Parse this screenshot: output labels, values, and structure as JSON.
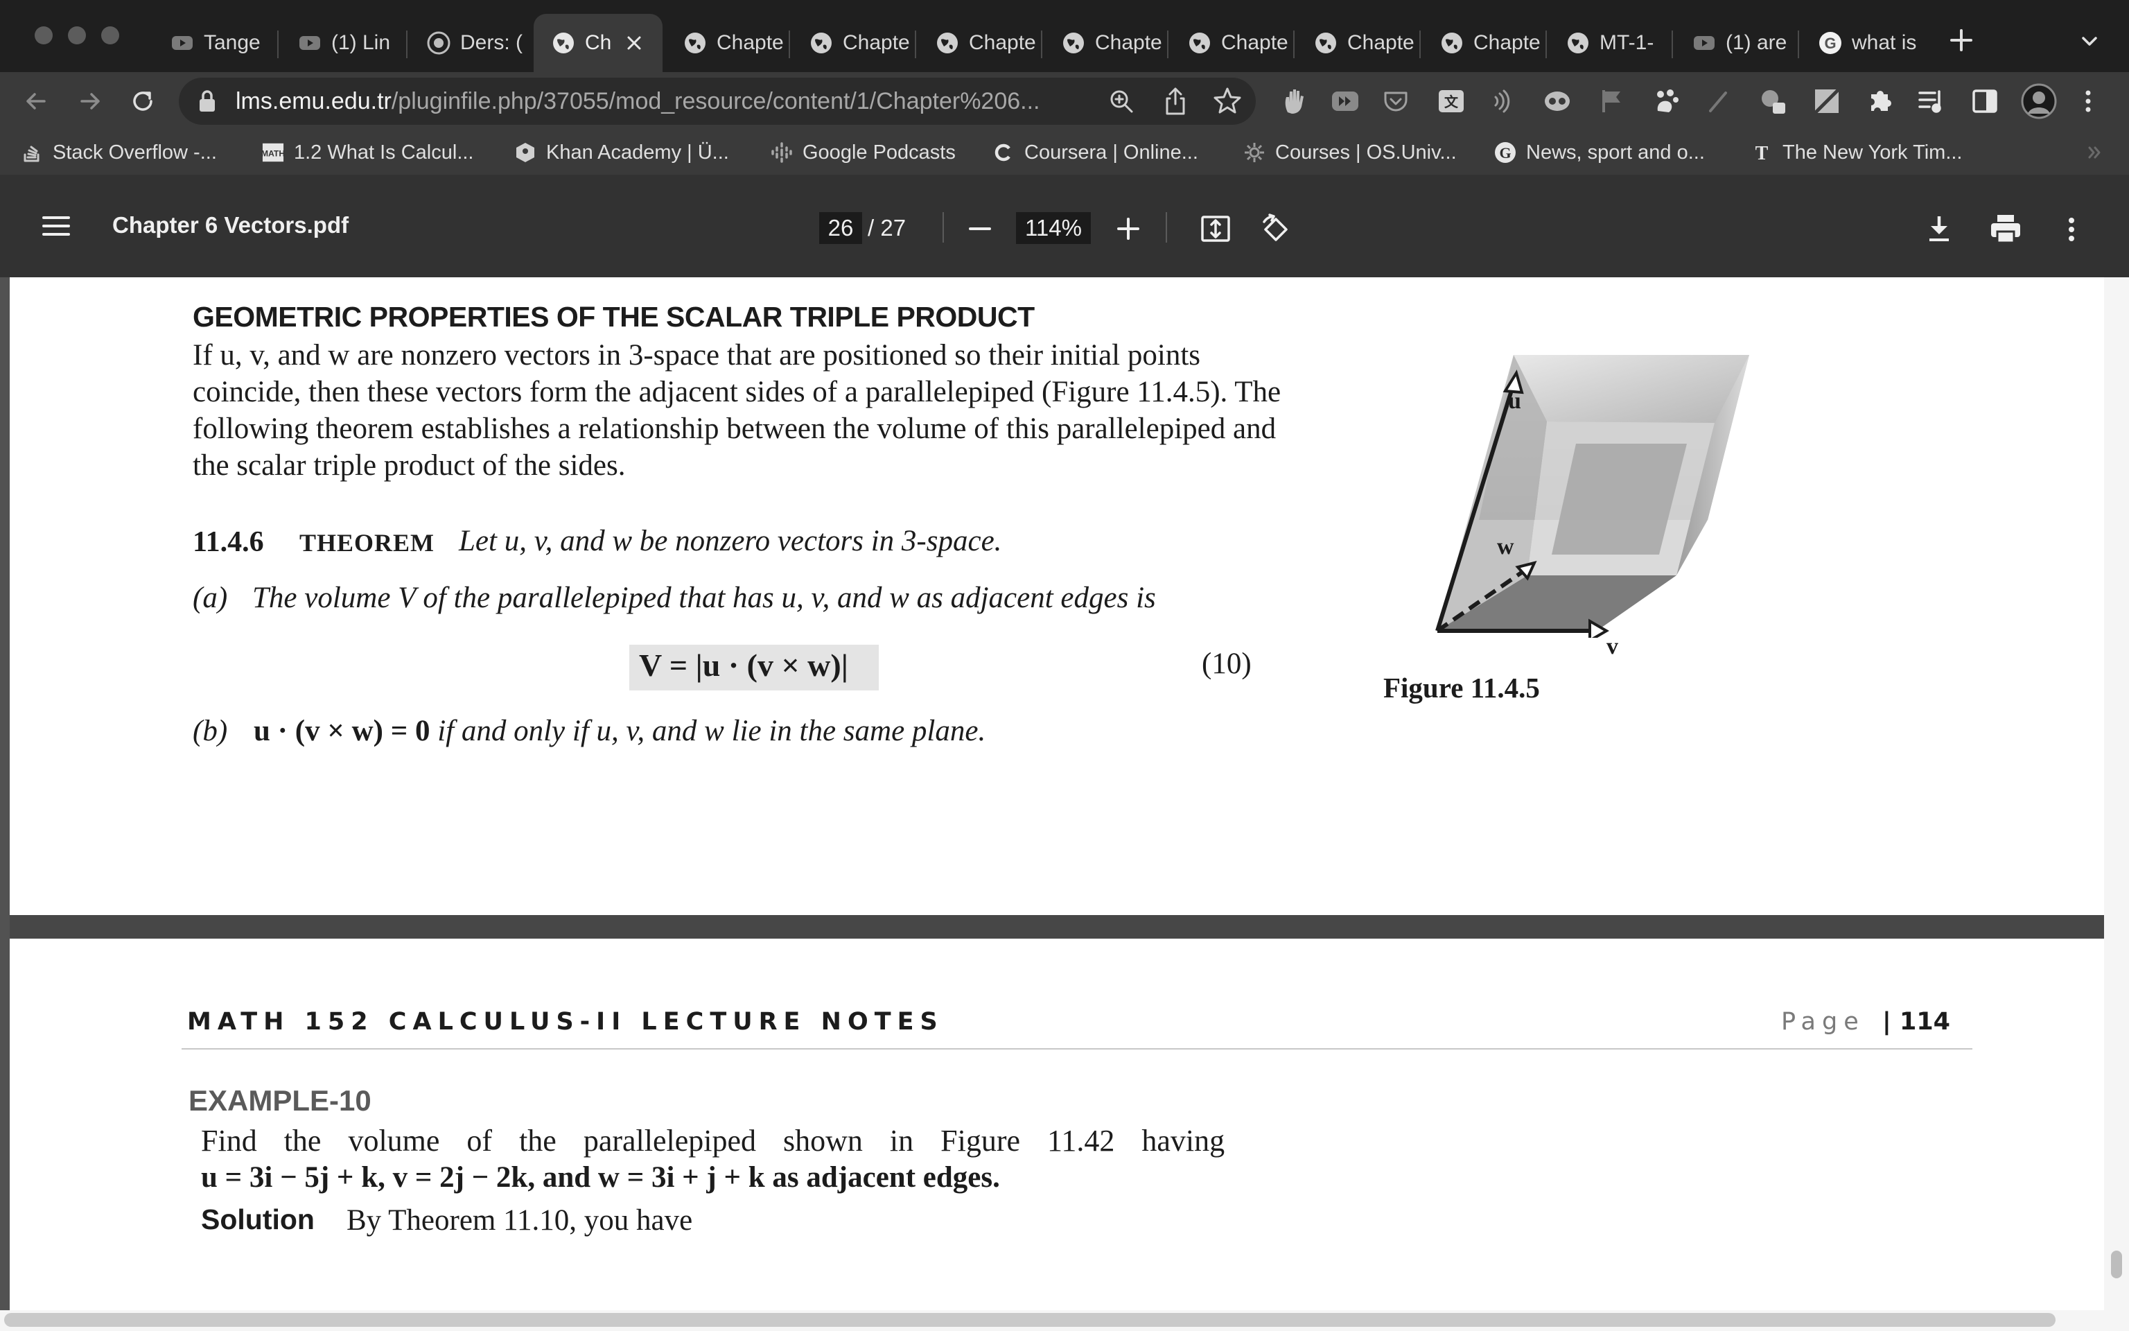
{
  "browser": {
    "tabs": [
      {
        "label": "Tange"
      },
      {
        "label": "(1) Lin"
      },
      {
        "label": "Ders: ("
      },
      {
        "label": "Ch",
        "active": true
      },
      {
        "label": "Chapte"
      },
      {
        "label": "Chapte"
      },
      {
        "label": "Chapte"
      },
      {
        "label": "Chapte"
      },
      {
        "label": "Chapte"
      },
      {
        "label": "Chapte"
      },
      {
        "label": "Chapte"
      },
      {
        "label": "MT-1-"
      },
      {
        "label": "(1) are"
      },
      {
        "label": "what is"
      }
    ],
    "url_domain": "lms.emu.edu.tr",
    "url_path": "/pluginfile.php/37055/mod_resource/content/1/Chapter%206...",
    "bookmarks": [
      {
        "label": "Stack Overflow -..."
      },
      {
        "label": "1.2 What Is Calcul..."
      },
      {
        "label": "Khan Academy | Ü..."
      },
      {
        "label": "Google Podcasts"
      },
      {
        "label": "Coursera | Online..."
      },
      {
        "label": "Courses | OS.Univ..."
      },
      {
        "label": "News, sport and o..."
      },
      {
        "label": "The New York Tim..."
      }
    ]
  },
  "viewer": {
    "filename": "Chapter 6 Vectors.pdf",
    "current_page": "26",
    "total_pages": "/ 27",
    "zoom": "114%"
  },
  "page1": {
    "heading": "GEOMETRIC PROPERTIES OF THE SCALAR TRIPLE PRODUCT",
    "para_lines": [
      "If u, v, and w are nonzero vectors in 3-space that are positioned so their initial points",
      "coincide, then these vectors form the adjacent sides of a parallelepiped (Figure 11.4.5). The",
      "following theorem establishes a relationship between the volume of this parallelepiped and",
      "the scalar triple product of the sides."
    ],
    "theorem_number": "11.4.6",
    "theorem_word": "THEOREM",
    "theorem_statement": "Let u, v, and w be nonzero vectors in 3-space.",
    "part_a_label": "(a)",
    "part_a_text": "The volume V of the parallelepiped that has u, v, and w as adjacent edges is",
    "formula": "V = |u · (v × w)|",
    "formula_number": "(10)",
    "part_b_label": "(b)",
    "part_b_formula": "u · (v × w) = 0",
    "part_b_text": " if and only if u, v, and w lie in the same plane.",
    "figure_labels": {
      "u": "u",
      "v": "v",
      "w": "w"
    },
    "figure_caption": "Figure 11.4.5"
  },
  "page2": {
    "header_title": "MATH 152 CALCULUS-II LECTURE NOTES",
    "page_word": "Page",
    "page_number": "| 114",
    "example_title": "EXAMPLE-10",
    "example_line1": "Find the volume of the parallelepiped shown in Figure 11.42 having",
    "example_line2": "u = 3i − 5j + k,  v = 2j − 2k, and w = 3i + j + k as adjacent edges.",
    "solution_label": "Solution",
    "solution_text": "By Theorem 11.10, you have"
  }
}
